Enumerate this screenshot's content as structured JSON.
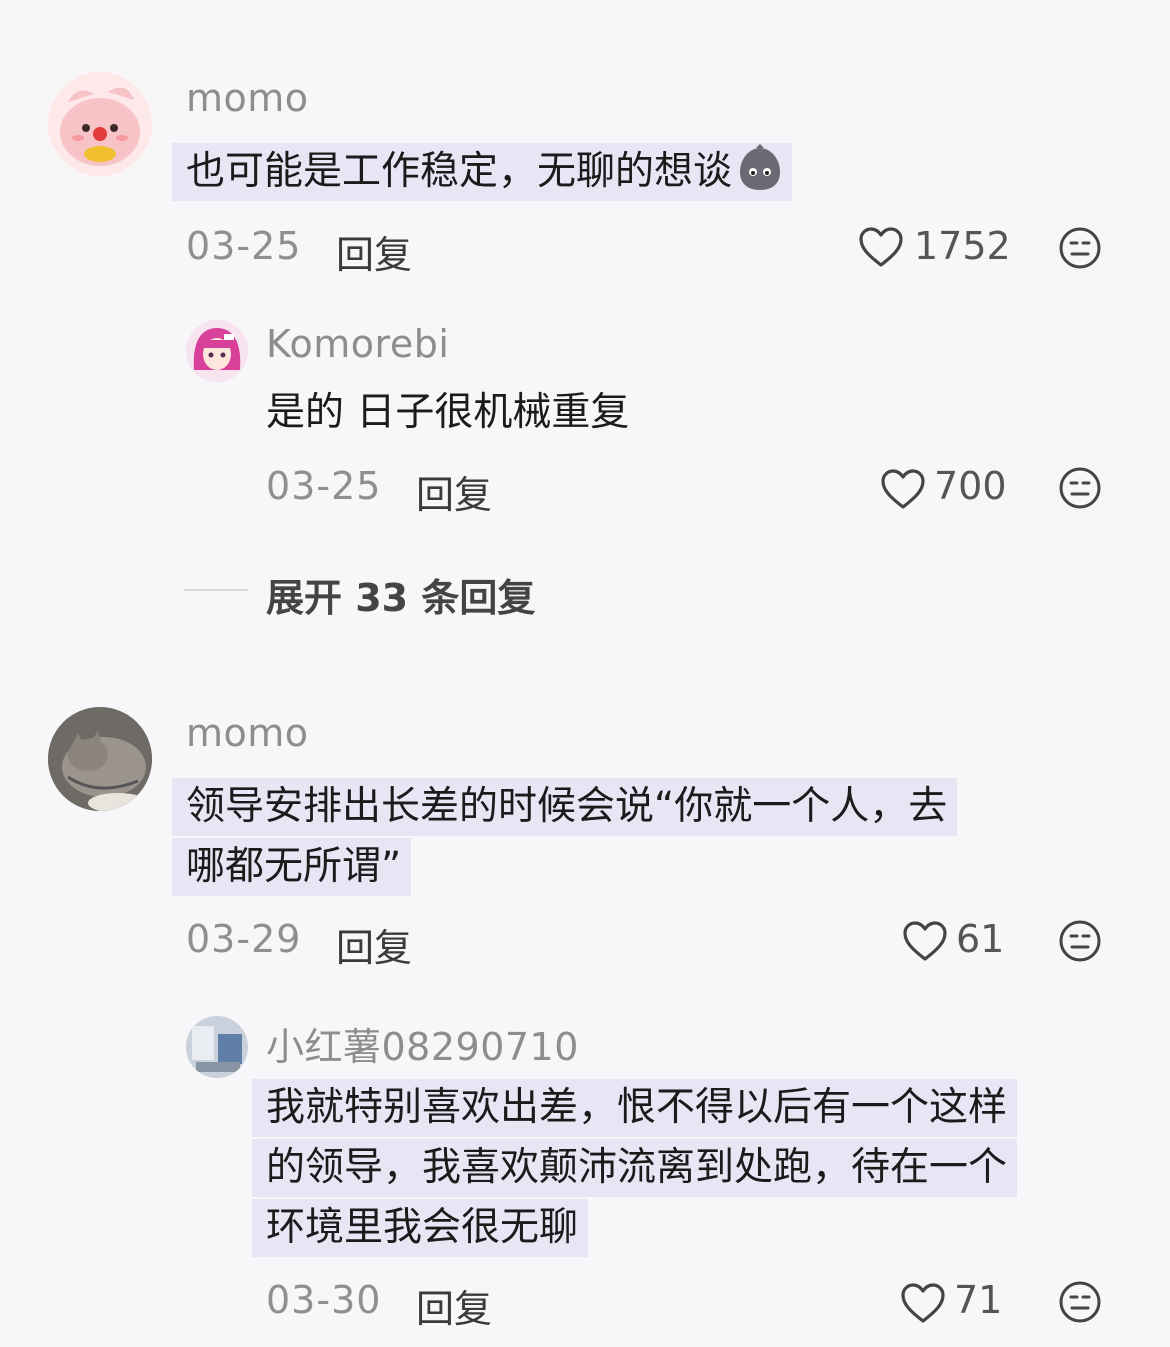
{
  "comments": [
    {
      "username": "momo",
      "text": "也可能是工作稳定，无聊的想谈",
      "emoji": "angry-ghost-emoji",
      "date": "03-25",
      "reply_label": "回复",
      "likes": "1752",
      "replies": [
        {
          "username": "Komorebi",
          "text": "是的 日子很机械重复",
          "date": "03-25",
          "reply_label": "回复",
          "likes": "700"
        }
      ],
      "expand_label": "展开 33 条回复"
    },
    {
      "username": "momo",
      "text_lines": [
        "领导安排出长差的时候会说“你就一个人，去",
        "哪都无所谓”"
      ],
      "date": "03-29",
      "reply_label": "回复",
      "likes": "61",
      "replies": [
        {
          "username": "小红薯08290710",
          "text_lines": [
            "我就特别喜欢出差，恨不得以后有一个这样",
            "的领导，我喜欢颠沛流离到处跑，待在一个",
            "环境里我会很无聊"
          ],
          "date": "03-30",
          "reply_label": "回复",
          "likes": "71"
        }
      ]
    }
  ],
  "icons": {
    "like": "heart-outline-icon",
    "dislike": "neutral-face-icon"
  },
  "colors": {
    "background": "#f7f7f9",
    "highlight": "#e8e6f5",
    "muted_text": "#8d8d8d"
  }
}
